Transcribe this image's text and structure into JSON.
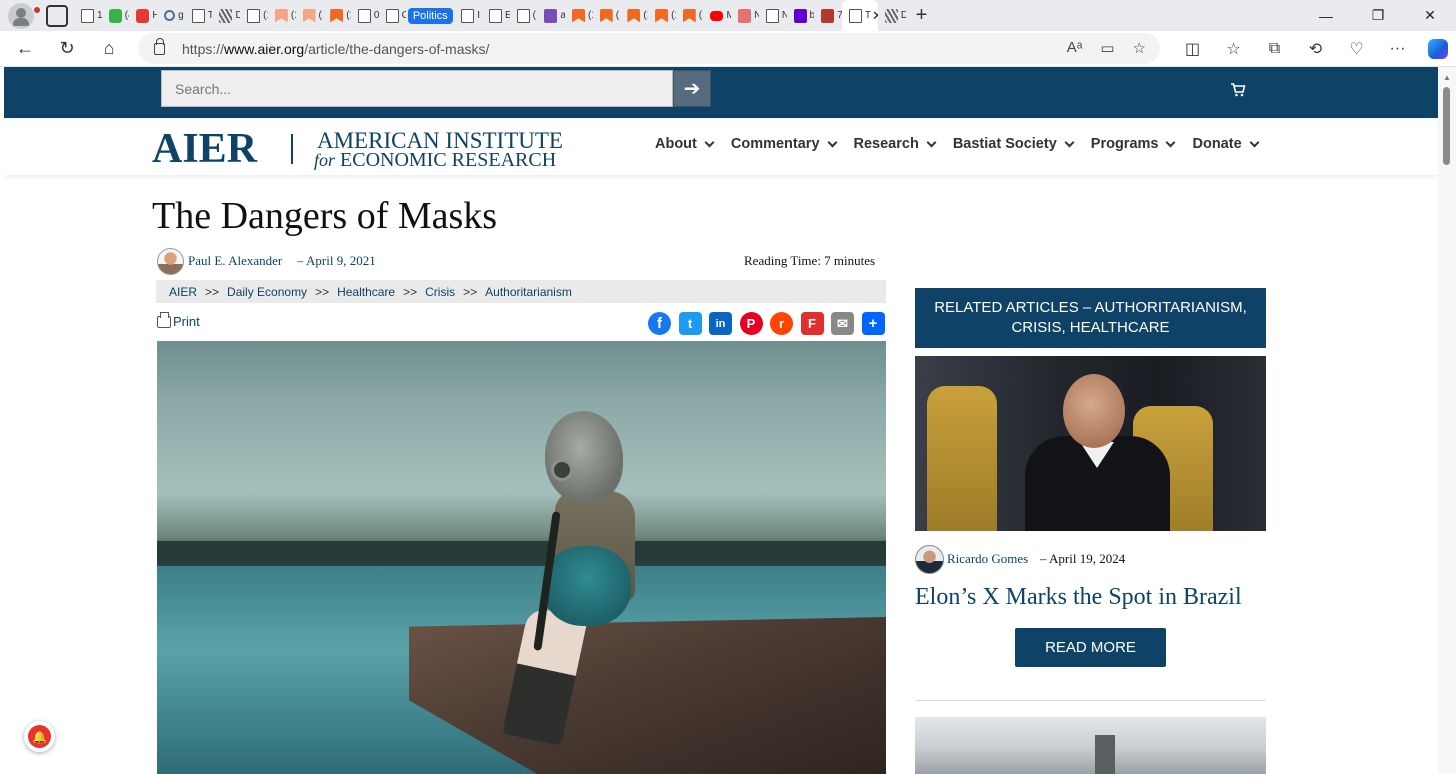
{
  "browser": {
    "tabs": [
      {
        "text": "1(",
        "icon": "doc"
      },
      {
        "text": "(4",
        "icon": "green"
      },
      {
        "text": "H",
        "icon": "red"
      },
      {
        "text": "g",
        "icon": "search"
      },
      {
        "text": "Tl",
        "icon": "doc"
      },
      {
        "text": "D",
        "icon": "pattern"
      },
      {
        "text": "(1",
        "icon": "doc"
      },
      {
        "text": "(1",
        "icon": "peach"
      },
      {
        "text": "(1",
        "icon": "peach"
      },
      {
        "text": "(1",
        "icon": "orange"
      },
      {
        "text": "0(",
        "icon": "doc"
      },
      {
        "text": "C",
        "icon": "doc"
      },
      {
        "text": "Politics",
        "icon": "pill"
      },
      {
        "text": "I s",
        "icon": "doc"
      },
      {
        "text": "El",
        "icon": "doc"
      },
      {
        "text": "(1",
        "icon": "doc"
      },
      {
        "text": "al",
        "icon": "purple"
      },
      {
        "text": "(1",
        "icon": "orange"
      },
      {
        "text": "(1",
        "icon": "orange"
      },
      {
        "text": "(1",
        "icon": "orange"
      },
      {
        "text": "(1",
        "icon": "orange"
      },
      {
        "text": "(1",
        "icon": "orange"
      },
      {
        "text": "M",
        "icon": "yt"
      },
      {
        "text": "N",
        "icon": "salmon"
      },
      {
        "text": "N",
        "icon": "doc"
      },
      {
        "text": "b",
        "icon": "yahoo"
      },
      {
        "text": "7:",
        "icon": "brick"
      },
      {
        "text": "T",
        "icon": "active"
      },
      {
        "text": "D",
        "icon": "pattern"
      }
    ],
    "url_prefix": "https://",
    "url_domain": "www.aier.org",
    "url_path": "/article/the-dangers-of-masks/"
  },
  "site": {
    "search_placeholder": "Search...",
    "logo_short": "AIER",
    "logo_line1": "AMERICAN INSTITUTE",
    "logo_line2_italic": "for",
    "logo_line2": " ECONOMIC RESEARCH",
    "nav": [
      "About",
      "Commentary",
      "Research",
      "Bastiat Society",
      "Programs",
      "Donate"
    ]
  },
  "article": {
    "title": "The Dangers of Masks",
    "author": "Paul E. Alexander",
    "date": "– April 9, 2021",
    "reading_time": "Reading Time: 7 minutes",
    "breadcrumbs": [
      "AIER",
      "Daily Economy",
      "Healthcare",
      "Crisis",
      "Authoritarianism"
    ],
    "breadcrumb_sep": ">>",
    "print_label": "Print",
    "share": [
      {
        "name": "facebook",
        "glyph": "f"
      },
      {
        "name": "twitter",
        "glyph": "t"
      },
      {
        "name": "linkedin",
        "glyph": "in"
      },
      {
        "name": "pinterest",
        "glyph": "P"
      },
      {
        "name": "reddit",
        "glyph": "r"
      },
      {
        "name": "flipboard",
        "glyph": "F"
      },
      {
        "name": "email",
        "glyph": "✉"
      },
      {
        "name": "share",
        "glyph": "+"
      }
    ]
  },
  "sidebar": {
    "header": "RELATED ARTICLES – AUTHORITARIANISM, CRISIS, HEALTHCARE",
    "item": {
      "author": "Ricardo Gomes",
      "date": "– April 19, 2024",
      "title": "Elon’s X Marks the Spot in Brazil",
      "button": "READ MORE"
    }
  }
}
